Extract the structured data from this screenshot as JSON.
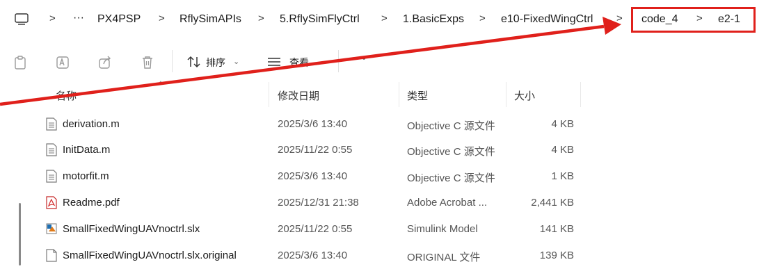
{
  "breadcrumb": {
    "overflow": "···",
    "items": [
      "PX4PSP",
      "RflySimAPIs",
      "5.RflySimFlyCtrl",
      "1.BasicExps",
      "e10-FixedWingCtrl",
      "code_4",
      "e2-1"
    ],
    "separator": ">"
  },
  "toolbar": {
    "sort_label": "排序",
    "view_label": "查看",
    "more_label": "···"
  },
  "columns": {
    "name": "名称",
    "date": "修改日期",
    "type": "类型",
    "size": "大小"
  },
  "files": [
    {
      "name": "derivation.m",
      "date": "2025/3/6 13:40",
      "type": "Objective C 源文件",
      "size": "4 KB",
      "icon": "text-file-icon"
    },
    {
      "name": "InitData.m",
      "date": "2025/11/22 0:55",
      "type": "Objective C 源文件",
      "size": "4 KB",
      "icon": "text-file-icon"
    },
    {
      "name": "motorfit.m",
      "date": "2025/3/6 13:40",
      "type": "Objective C 源文件",
      "size": "1 KB",
      "icon": "text-file-icon"
    },
    {
      "name": "Readme.pdf",
      "date": "2025/12/31 21:38",
      "type": "Adobe Acrobat ...",
      "size": "2,441 KB",
      "icon": "pdf-file-icon"
    },
    {
      "name": "SmallFixedWingUAVnoctrl.slx",
      "date": "2025/11/22 0:55",
      "type": "Simulink Model",
      "size": "141 KB",
      "icon": "simulink-file-icon"
    },
    {
      "name": "SmallFixedWingUAVnoctrl.slx.original",
      "date": "2025/3/6 13:40",
      "type": "ORIGINAL 文件",
      "size": "139 KB",
      "icon": "blank-file-icon"
    }
  ],
  "colors": {
    "annotation": "#e0201b"
  }
}
